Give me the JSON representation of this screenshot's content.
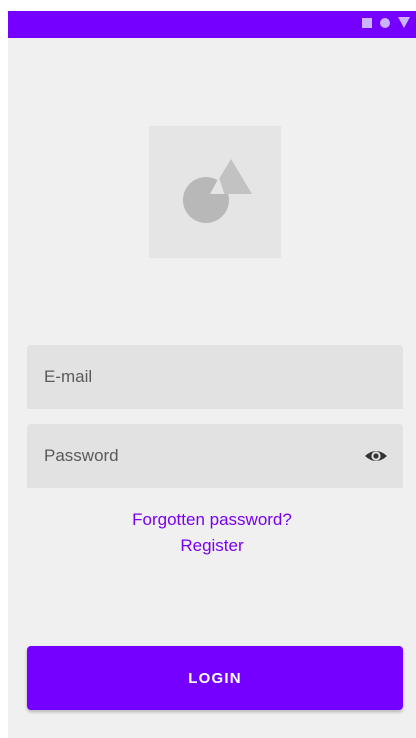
{
  "status_bar": {
    "color": "#7600ff",
    "icons": [
      "square-icon",
      "circle-icon",
      "triangle-icon"
    ]
  },
  "logo": {
    "icon": "shapes-logo-icon"
  },
  "form": {
    "email_placeholder": "E-mail",
    "password_placeholder": "Password",
    "password_toggle_icon": "eye-icon"
  },
  "links": {
    "forgot_password": "Forgotten password?",
    "register": "Register"
  },
  "actions": {
    "login_label": "LOGIN"
  },
  "colors": {
    "accent": "#7600ff",
    "link": "#7a00f0",
    "background": "#f0f0f0",
    "field": "#e2e2e2"
  }
}
